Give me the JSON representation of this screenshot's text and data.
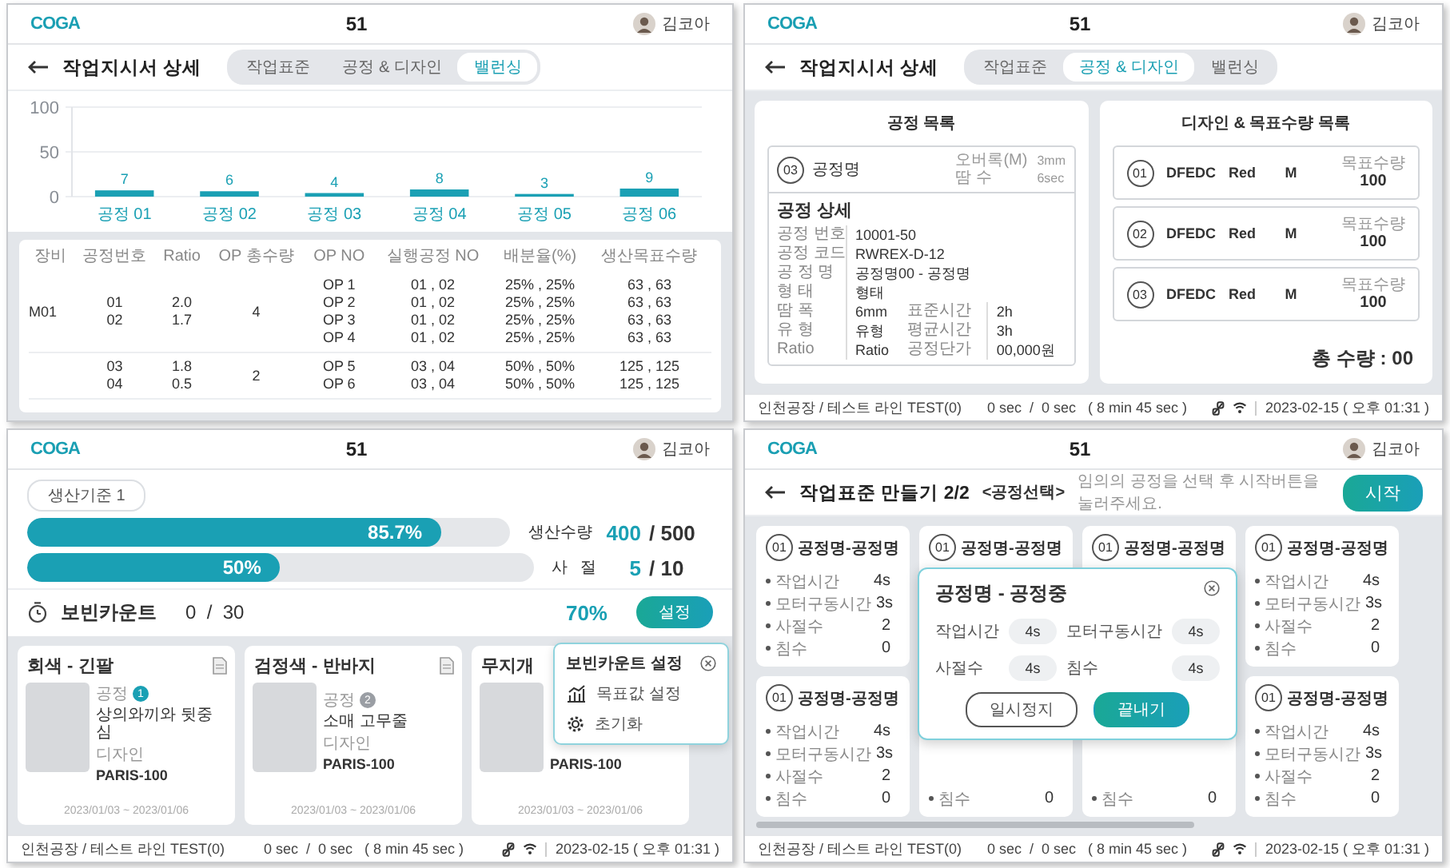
{
  "panels": [
    {
      "kind": "balancing",
      "header": {
        "logo": "COGA",
        "title": "51",
        "user": "김코아"
      },
      "page_title": "작업지시서 상세",
      "tabs": [
        {
          "label": "작업표준",
          "selected": false
        },
        {
          "label": "공정 & 디자인",
          "selected": false
        },
        {
          "label": "밸런싱",
          "selected": true
        }
      ],
      "chart_data": {
        "type": "bar",
        "categories": [
          "공정 01",
          "공정 02",
          "공정 03",
          "공정 04",
          "공정 05",
          "공정 06"
        ],
        "values": [
          7,
          6,
          4,
          8,
          3,
          9
        ],
        "ylim": [
          0,
          100
        ],
        "yticks": [
          0,
          50,
          100
        ],
        "data_labels": true
      },
      "table": {
        "columns": [
          "장비",
          "공정번호",
          "Ratio",
          "OP 총수량",
          "OP NO",
          "실행공정 NO",
          "배분율(%)",
          "생산목표수량"
        ],
        "rows": [
          {
            "equipment": "M01",
            "process_nos": [
              "01",
              "02"
            ],
            "ratios": [
              "2.0",
              "1.7"
            ],
            "op_total": "4",
            "op_nos": [
              "OP 1",
              "OP 2",
              "OP 3",
              "OP 4"
            ],
            "run_nos": [
              "01 , 02",
              "01 , 02",
              "01 , 02",
              "01 , 02"
            ],
            "shares": [
              "25% , 25%",
              "25% , 25%",
              "25% , 25%",
              "25% , 25%"
            ],
            "targets": [
              "63 , 63",
              "63 , 63",
              "63 , 63",
              "63 , 63"
            ]
          },
          {
            "process_nos": [
              "03",
              "04"
            ],
            "ratios": [
              "1.8",
              "0.5"
            ],
            "op_total": "2",
            "op_nos": [
              "OP 5",
              "OP 6"
            ],
            "run_nos": [
              "03 , 04",
              "03 , 04"
            ],
            "shares": [
              "50% , 50%",
              "50% , 50%"
            ],
            "targets": [
              "125 , 125",
              "125 , 125"
            ]
          }
        ]
      }
    },
    {
      "kind": "process_design",
      "header": {
        "logo": "COGA",
        "title": "51",
        "user": "김코아"
      },
      "page_title": "작업지시서 상세",
      "tabs": [
        {
          "label": "작업표준",
          "selected": false
        },
        {
          "label": "공정 & 디자인",
          "selected": true
        },
        {
          "label": "밸런싱",
          "selected": false
        }
      ],
      "process_list": {
        "title": "공정 목록",
        "item": {
          "number": "03",
          "name": "공정명",
          "meta": [
            {
              "label": "오버록(M)",
              "value": "3mm"
            },
            {
              "label": "땀 수",
              "value": "6sec"
            }
          ]
        },
        "detail_title": "공정 상세",
        "detail_rows": [
          {
            "label": "공정 번호",
            "value": "10001-50"
          },
          {
            "label": "공정 코드",
            "value": "RWREX-D-12"
          },
          {
            "label": "공 정 명",
            "value": "공정명00 - 공정명"
          },
          {
            "label": "형 태",
            "value": "형태"
          },
          {
            "label": "땀 폭",
            "value": "6mm",
            "label2": "표준시간",
            "value2": "2h"
          },
          {
            "label": "유 형",
            "value": "유형",
            "label2": "평균시간",
            "value2": "3h"
          },
          {
            "label": "Ratio",
            "value": "Ratio",
            "label2": "공정단가",
            "value2": "00,000원"
          }
        ]
      },
      "design_list": {
        "title": "디자인 & 목표수량 목록",
        "items": [
          {
            "number": "01",
            "design": "DFEDC",
            "color_name": "Red",
            "size": "M",
            "target_label": "목표수량",
            "target": "100"
          },
          {
            "number": "02",
            "design": "DFEDC",
            "color_name": "Red",
            "size": "M",
            "target_label": "목표수량",
            "target": "100"
          },
          {
            "number": "03",
            "design": "DFEDC",
            "color_name": "Red",
            "size": "M",
            "target_label": "목표수량",
            "target": "100"
          }
        ],
        "total": "총 수량 : 00"
      },
      "status": {
        "location": "인천공장 / 테스트 라인 TEST(0)",
        "timer": "0 sec  /  0 sec   ( 8 min 45 sec )",
        "datetime": "2023-02-15 ( 오후 01:31 )"
      }
    },
    {
      "kind": "bobbin",
      "header": {
        "logo": "COGA",
        "title": "51",
        "user": "김코아"
      },
      "standard": "생산기준 1",
      "progress": [
        {
          "level": 0.857,
          "text": "85.7%",
          "label": "생산수량",
          "value": "400",
          "total": "/ 500"
        },
        {
          "level": 0.5,
          "text": "50%",
          "label": "사   절",
          "value": "5",
          "total": "/ 10"
        }
      ],
      "bobbin": {
        "label": "보빈카운트",
        "count": "0  /  30",
        "percent": "70%",
        "button": "설정"
      },
      "popover": {
        "title": "보빈카운트 설정",
        "items": [
          {
            "label": "목표값 설정",
            "kind": "target"
          },
          {
            "label": "초기화",
            "kind": "reset"
          }
        ]
      },
      "cards": [
        {
          "title": "회색 - 긴팔",
          "process_label": "공정",
          "process_no": "1",
          "active": true,
          "process_name": "상의와끼와 뒷중심",
          "design_label": "디자인",
          "design": "PARIS-100",
          "dates": "2023/01/03 ~ 2023/01/06"
        },
        {
          "title": "검정색 - 반바지",
          "process_label": "공정",
          "process_no": "2",
          "active": false,
          "process_name": "소매 고무줄",
          "design_label": "디자인",
          "design": "PARIS-100",
          "dates": "2023/01/03 ~ 2023/01/06"
        },
        {
          "title": "무지개",
          "design": "PARIS-100",
          "dates": "2023/01/03 ~ 2023/01/06"
        }
      ],
      "status": {
        "location": "인천공장 / 테스트 라인 TEST(0)",
        "timer": "0 sec  /  0 sec   ( 8 min 45 sec )",
        "datetime": "2023-02-15 ( 오후 01:31 )"
      }
    },
    {
      "kind": "standard_create",
      "header": {
        "logo": "COGA",
        "title": "51",
        "user": "김코아"
      },
      "page_title": "작업표준 만들기 2/2",
      "subtitle": "<공정선택>",
      "hint": "임의의 공정을 선택 후 시작버튼을 눌러주세요.",
      "start_button": "시작",
      "cards": [
        {
          "number": "01",
          "name": "공정명-공정명",
          "stats": [
            {
              "label": "작업시간",
              "value": "4s"
            },
            {
              "label": "모터구동시간",
              "value": "3s"
            },
            {
              "label": "사절수",
              "value": "2"
            },
            {
              "label": "침수",
              "value": "0"
            }
          ]
        },
        {
          "number": "01",
          "name": "공정명-공정명"
        },
        {
          "number": "01",
          "name": "공정명-공정명"
        },
        {
          "number": "01",
          "name": "공정명-공정명",
          "stats": [
            {
              "label": "작업시간",
              "value": "4s"
            },
            {
              "label": "모터구동시간",
              "value": "3s"
            },
            {
              "label": "사절수",
              "value": "2"
            },
            {
              "label": "침수",
              "value": "0"
            }
          ]
        },
        {
          "number": "01",
          "name": "공정명-공정명",
          "stats": [
            {
              "label": "작업시간",
              "value": "4s"
            },
            {
              "label": "모터구동시간",
              "value": "3s"
            },
            {
              "label": "사절수",
              "value": "2"
            },
            {
              "label": "침수",
              "value": "0"
            }
          ]
        },
        {
          "stats": [
            {
              "label": "침수",
              "value": "0"
            }
          ]
        },
        {
          "stats": [
            {
              "label": "침수",
              "value": "0"
            }
          ]
        },
        {
          "number": "01",
          "name": "공정명-공정명",
          "stats": [
            {
              "label": "작업시간",
              "value": "4s"
            },
            {
              "label": "모터구동시간",
              "value": "3s"
            },
            {
              "label": "사절수",
              "value": "2"
            },
            {
              "label": "침수",
              "value": "0"
            }
          ]
        }
      ],
      "modal": {
        "title": "공정명 - 공정중",
        "fields": [
          {
            "label": "작업시간",
            "value": "4s"
          },
          {
            "label": "모터구동시간",
            "value": "4s"
          },
          {
            "label": "사절수",
            "value": "4s"
          },
          {
            "label": "침수",
            "value": "4s"
          }
        ],
        "buttons": [
          {
            "label": "일시정지",
            "kind": "secondary"
          },
          {
            "label": "끝내기",
            "kind": "primary"
          }
        ]
      },
      "status": {
        "location": "인천공장 / 테스트 라인 TEST(0)",
        "timer": "0 sec  /  0 sec   ( 8 min 45 sec )",
        "datetime": "2023-02-15 ( 오후 01:31 )"
      }
    }
  ]
}
